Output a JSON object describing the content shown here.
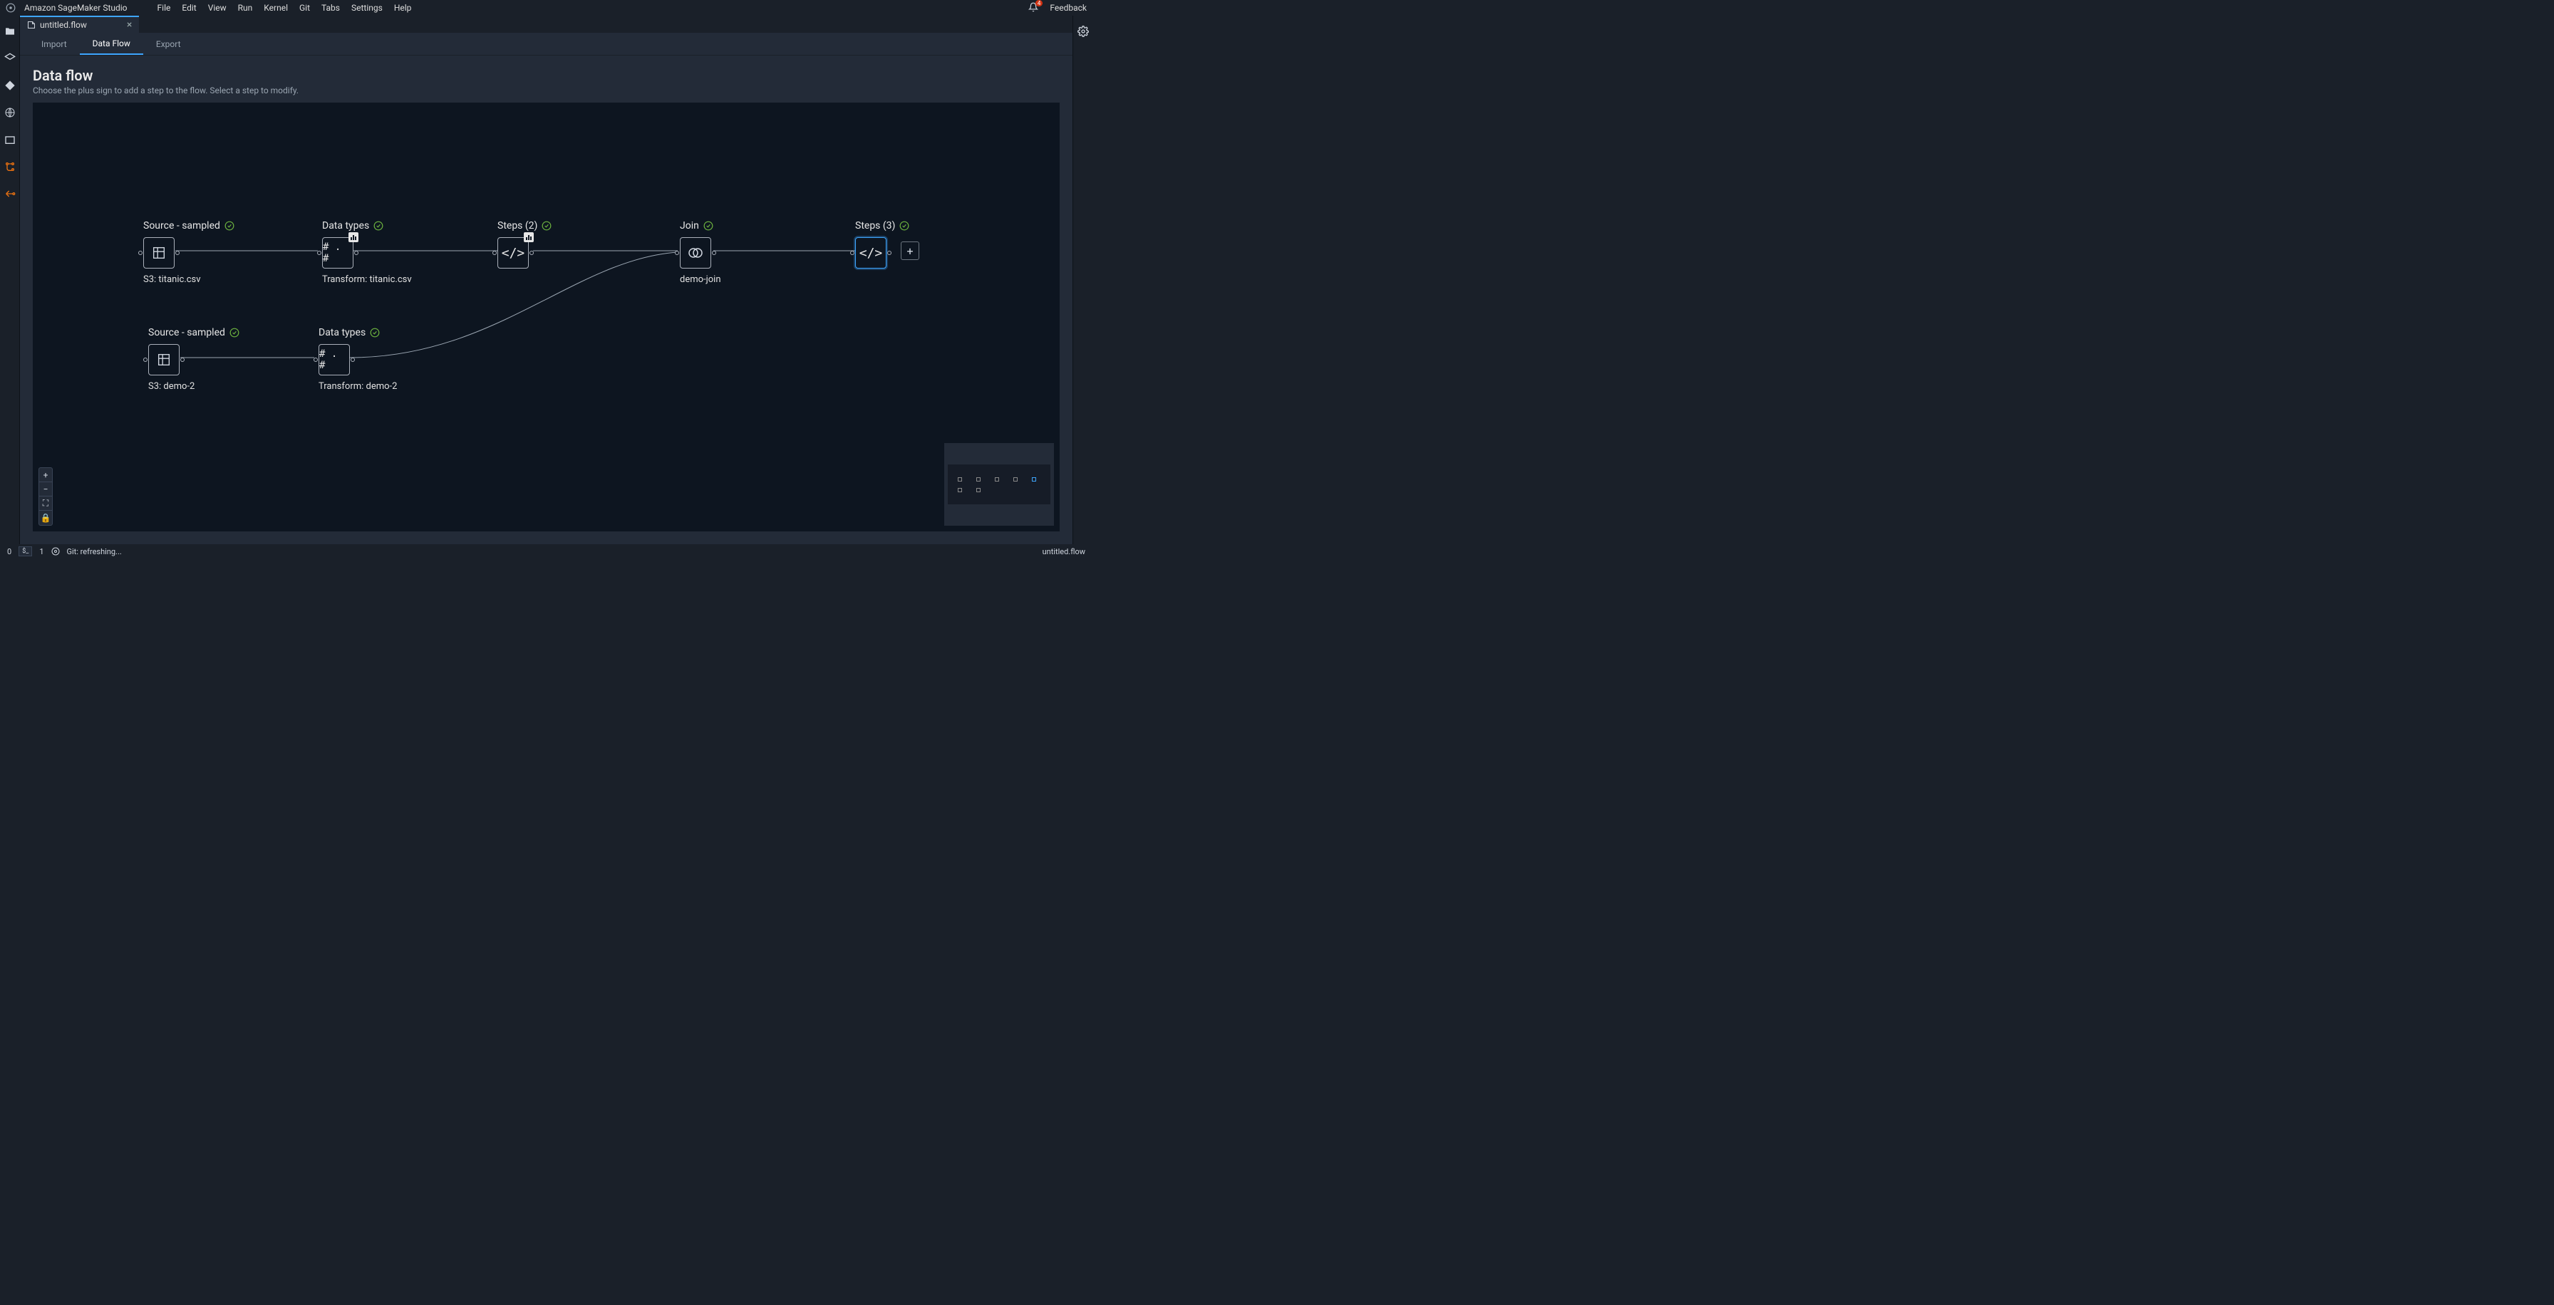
{
  "app": {
    "title": "Amazon SageMaker Studio"
  },
  "menu": [
    "File",
    "Edit",
    "View",
    "Run",
    "Kernel",
    "Git",
    "Tabs",
    "Settings",
    "Help"
  ],
  "topbar": {
    "feedback": "Feedback",
    "notification_count": "4"
  },
  "tab": {
    "name": "untitled.flow",
    "close": "×"
  },
  "subtabs": {
    "import": "Import",
    "dataflow": "Data Flow",
    "export": "Export"
  },
  "heading": {
    "title": "Data flow",
    "subtitle": "Choose the plus sign to add a step to the flow. Select a step to modify."
  },
  "nodes": {
    "source1": {
      "title": "Source - sampled",
      "sub": "S3: titanic.csv"
    },
    "types1": {
      "title": "Data types",
      "sub": "Transform: titanic.csv",
      "box": "# . #"
    },
    "steps2": {
      "title": "Steps (2)"
    },
    "join": {
      "title": "Join",
      "sub": "demo-join"
    },
    "steps3": {
      "title": "Steps (3)"
    },
    "source2": {
      "title": "Source - sampled",
      "sub": "S3: demo-2"
    },
    "types2": {
      "title": "Data types",
      "sub": "Transform: demo-2",
      "box": "# . #"
    },
    "add": {
      "label": "+"
    }
  },
  "zoom": {
    "in": "+",
    "out": "−",
    "fit": "⛶",
    "lock": "🔒"
  },
  "statusbar": {
    "left_zero": "0",
    "terminal_count": "1",
    "git": "Git: refreshing...",
    "right": "untitled.flow",
    "term": "$_"
  }
}
